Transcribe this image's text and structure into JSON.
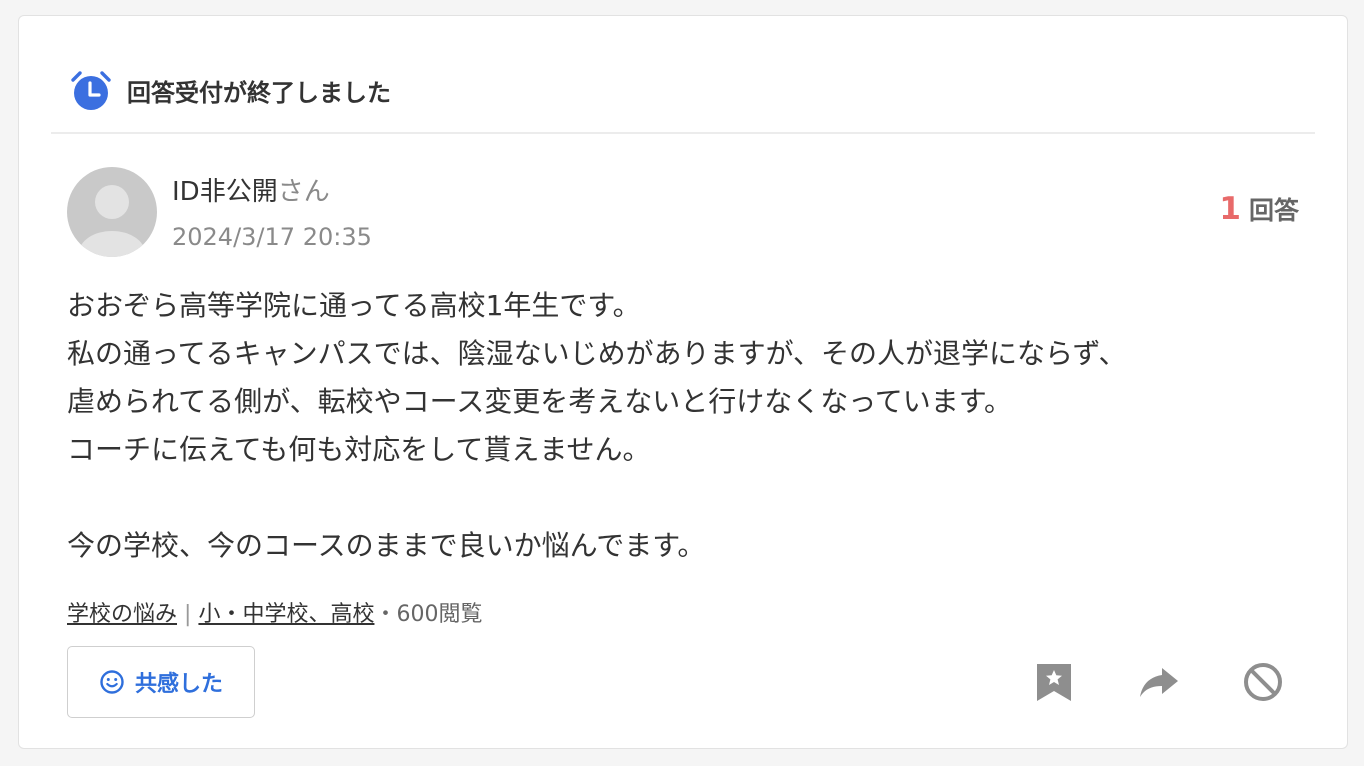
{
  "status": {
    "icon": "alarm-clock-icon",
    "text": "回答受付が終了しました",
    "accent_color": "#3b6fe0"
  },
  "author": {
    "avatar": "default-user-avatar",
    "name": "ID非公開",
    "suffix": "さん",
    "date": "2024/3/17 20:35"
  },
  "answers": {
    "count": "1",
    "label": "回答",
    "count_color": "#e86a6a"
  },
  "question": {
    "lines": [
      "おおぞら高等学院に通ってる高校1年生です。",
      "私の通ってるキャンパスでは、陰湿ないじめがありますが、その人が退学にならず、",
      "虐められてる側が、転校やコース変更を考えないと行けなくなっています。",
      "コーチに伝えても何も対応をして貰えません。",
      "",
      "今の学校、今のコースのままで良いか悩んでます。"
    ]
  },
  "meta": {
    "category_1": "学校の悩み",
    "separator": "|",
    "category_2": "小・中学校、高校",
    "views": "・600閲覧"
  },
  "actions": {
    "empathy_label": "共感した",
    "empathy_icon": "smile-icon",
    "icons": [
      "bookmark-star-icon",
      "share-arrow-icon",
      "block-icon"
    ]
  }
}
